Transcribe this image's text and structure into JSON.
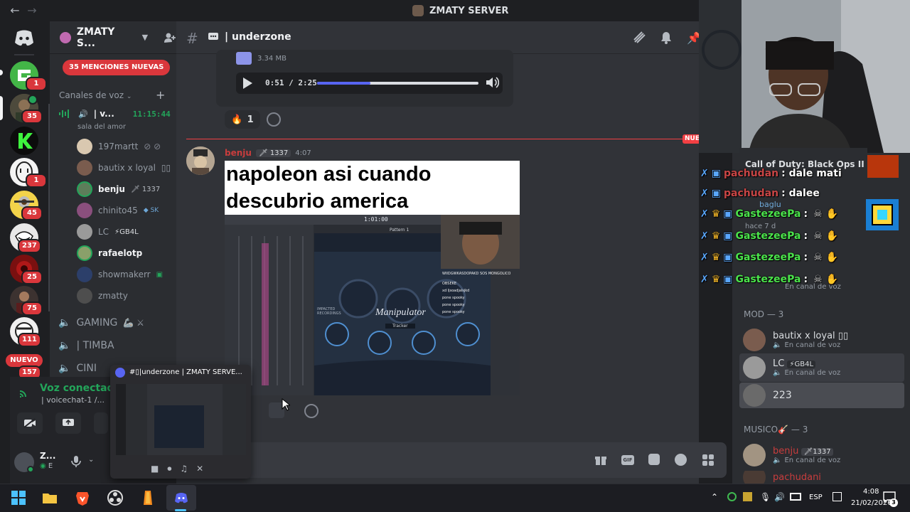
{
  "window": {
    "server_title": "ZMATY SERVER",
    "back_arrow": "←",
    "forward_arrow": "→"
  },
  "rail": {
    "badges": [
      "1",
      "35",
      "1",
      "45",
      "237",
      "25",
      "75",
      "111",
      "157"
    ],
    "nuevo_label": "NUEVO"
  },
  "sidebar": {
    "guild_name": "ZMATY S...",
    "mentions_label": "35 MENCIONES NUEVAS",
    "voice_category": "Canales de voz",
    "active_channel": {
      "name": "| v...",
      "time": "11:15:44",
      "status": "sala del amor"
    },
    "voice_users": [
      {
        "name": "197martt",
        "tag": ""
      },
      {
        "name": "bautix x loyal",
        "tag": "▯▯"
      },
      {
        "name": "benju",
        "tag": "1337"
      },
      {
        "name": "chinito45",
        "tag": "SK"
      },
      {
        "name": "LC",
        "tag": "GB4L"
      },
      {
        "name": "rafaelotp",
        "tag": ""
      },
      {
        "name": "showmakerr",
        "tag": ""
      },
      {
        "name": "zmatty",
        "tag": ""
      }
    ],
    "channels": [
      {
        "name": "GAMING",
        "emoji": "🦾 ⚔"
      },
      {
        "name": "| TIMBA",
        "emoji": ""
      },
      {
        "name": "CINI",
        "emoji": ""
      }
    ]
  },
  "voice_panel": {
    "status": "Voz conectada",
    "channel": "| voicechat-1 /..."
  },
  "user_panel": {
    "name": "Z...",
    "status": "E"
  },
  "thumbnail": {
    "title": "#▯|underzone | ZMATY SERVE..."
  },
  "chat": {
    "channel_name": "| underzone",
    "attachment": {
      "size": "3.34 MB",
      "time": "0:51 / 2:25",
      "progress": 0.33
    },
    "reaction": {
      "emoji": "🔥",
      "count": "1"
    },
    "new_label": "NUE",
    "message": {
      "author": "benju",
      "tag": "1337",
      "time": "4:07",
      "caption": "napoleon asi cuando descubrio america",
      "plugin_title": "Manipulator",
      "plugin_preset": "Tracker",
      "plugin_header": "IMPACTED RECORDINGS",
      "daw_time": "1:01:00",
      "daw_pattern": "Pattern 1",
      "overlay_title": "WIIDGWKASDOPAKD SOS MONGOLICO",
      "overlay_lines": [
        "OBSEKE",
        "xd ljsoadjalsjkd",
        "pone spooky",
        "pone spooky",
        "pone spooky"
      ]
    }
  },
  "overlay": {
    "game_title": "Call of Duty: Black Ops II",
    "chat_lines": [
      {
        "user": "pachudan",
        "text": ": dale mati"
      },
      {
        "user": "pachudan",
        "text": ": dalee"
      },
      {
        "user": "GastezeePa",
        "text": ":"
      },
      {
        "user": "GastezeePa",
        "text": ":"
      },
      {
        "user": "GastezeePa",
        "text": ":"
      },
      {
        "user": "GastezeePa",
        "text": ":"
      }
    ],
    "bg_user": "baglu",
    "bg_sub": "hace 7 d",
    "bg_sub2": "En canal de voz"
  },
  "members": {
    "mod_header": "MOD — 3",
    "mods": [
      {
        "name": "bautix x loyal ▯▯",
        "sub": "En canal de voz",
        "tag": ""
      },
      {
        "name": "LC",
        "sub": "En canal de voz",
        "tag": "GB4L"
      },
      {
        "name": "223",
        "sub": "",
        "tag": ""
      }
    ],
    "musico_header": "MUSICO🎸 — 3",
    "musicos": [
      {
        "name": "benju",
        "sub": "En canal de voz",
        "tag": "1337"
      },
      {
        "name": "pachudani",
        "sub": "",
        "tag": ""
      }
    ]
  },
  "taskbar": {
    "lang": "ESP",
    "time": "4:08",
    "date": "21/02/2026",
    "notif_count": "3"
  },
  "colors": {
    "accent": "#5865f2",
    "danger": "#da373c",
    "online": "#23a55a",
    "mention_name": "#c83d3d"
  }
}
